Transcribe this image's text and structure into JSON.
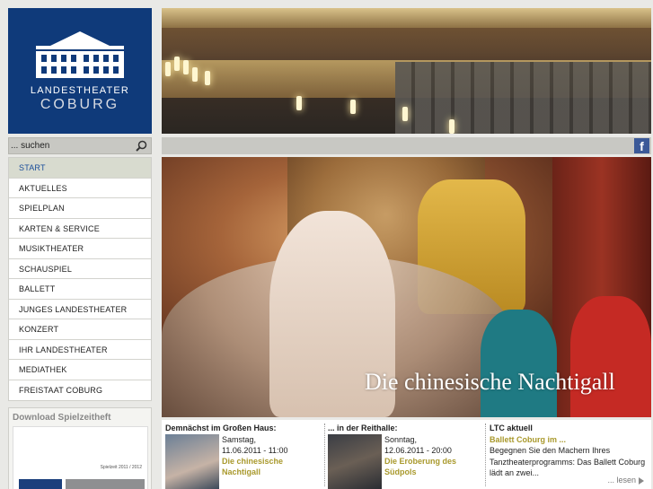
{
  "logo": {
    "line1": "LANDESTHEATER",
    "line2": "COBURG"
  },
  "search": {
    "placeholder": "... suchen",
    "icon": "search-icon"
  },
  "social": {
    "icon": "facebook-icon",
    "glyph": "f"
  },
  "nav": {
    "items": [
      {
        "label": "START",
        "active": true
      },
      {
        "label": "AKTUELLES"
      },
      {
        "label": "SPIELPLAN"
      },
      {
        "label": "KARTEN & SERVICE"
      },
      {
        "label": "MUSIKTHEATER"
      },
      {
        "label": "SCHAUSPIEL"
      },
      {
        "label": "BALLETT"
      },
      {
        "label": "JUNGES LANDESTHEATER"
      },
      {
        "label": "KONZERT"
      },
      {
        "label": "IHR LANDESTHEATER"
      },
      {
        "label": "MEDIATHEK"
      },
      {
        "label": "FREISTAAT COBURG"
      }
    ]
  },
  "download": {
    "title": "Download Spielzeitheft",
    "cover_text": "Spielzeit 2011 / 2012"
  },
  "hero": {
    "caption": "Die chinesische Nachtigall"
  },
  "teasers": {
    "grosses_haus": {
      "heading": "Demnächst im Großen Haus:",
      "day": "Samstag,",
      "datetime": "11.06.2011 - 11:00",
      "link": "Die chinesische Nachtigall"
    },
    "reithalle": {
      "heading": "... in der Reithalle:",
      "day": "Sonntag,",
      "datetime": "12.06.2011 - 20:00",
      "link": "Die Eroberung des Südpols"
    },
    "ltc": {
      "heading": "LTC aktuell",
      "link": "Ballett Coburg im ...",
      "text": "Begegnen Sie den Machern Ihres Tanztheaterprogramms: Das Ballett Coburg lädt an zwei...",
      "more": "... lesen"
    }
  },
  "colors": {
    "brand_blue": "#0f3a7a",
    "link_olive": "#a9992c",
    "facebook_blue": "#3b5998"
  }
}
